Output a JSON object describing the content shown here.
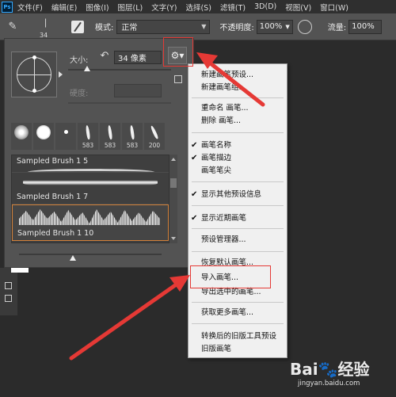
{
  "app": {
    "logo": "Ps"
  },
  "menubar": {
    "items": [
      "文件(F)",
      "编辑(E)",
      "图像(I)",
      "图层(L)",
      "文字(Y)",
      "选择(S)",
      "滤镜(T)",
      "3D(D)",
      "视图(V)",
      "窗口(W)"
    ]
  },
  "options_bar": {
    "brush_size": "34",
    "mode_label": "模式:",
    "mode_value": "正常",
    "opacity_label": "不透明度:",
    "opacity_value": "100%",
    "flow_label": "流量:",
    "flow_value": "100%"
  },
  "brush_panel": {
    "size_label": "大小:",
    "size_value": "34 像素",
    "hardness_label": "硬度:",
    "thumbnails": [
      "",
      "",
      "",
      "583",
      "583",
      "583",
      "200"
    ],
    "brushes": [
      {
        "name": "Sampled Brush 1 5"
      },
      {
        "name": "Sampled Brush 1 7"
      },
      {
        "name": "Sampled Brush 1 10"
      }
    ]
  },
  "context_menu": {
    "items": [
      {
        "label": "新建画笔预设...",
        "checked": false
      },
      {
        "label": "新建画笔组...",
        "checked": false
      },
      {
        "label": "重命名 画笔...",
        "checked": false
      },
      {
        "label": "删除 画笔...",
        "checked": false
      },
      {
        "label": "画笔名称",
        "checked": true
      },
      {
        "label": "画笔描边",
        "checked": true
      },
      {
        "label": "画笔笔尖",
        "checked": false
      },
      {
        "label": "显示其他预设信息",
        "checked": true
      },
      {
        "label": "显示近期画笔",
        "checked": true
      },
      {
        "label": "预设管理器...",
        "checked": false
      },
      {
        "label": "恢复默认画笔...",
        "checked": false
      },
      {
        "label": "导入画笔...",
        "checked": false,
        "highlighted": true
      },
      {
        "label": "导出选中的画笔...",
        "checked": false
      },
      {
        "label": "获取更多画笔...",
        "checked": false
      },
      {
        "label": "转换后的旧版工具预设",
        "checked": false
      },
      {
        "label": "旧版画笔",
        "checked": false
      }
    ]
  },
  "watermark": {
    "brand": "Bai",
    "suffix": "经验",
    "url": "jingyan.baidu.com"
  },
  "colors": {
    "highlight": "#e53935",
    "panel": "#535353",
    "menu_bg": "#f0f0f0"
  }
}
